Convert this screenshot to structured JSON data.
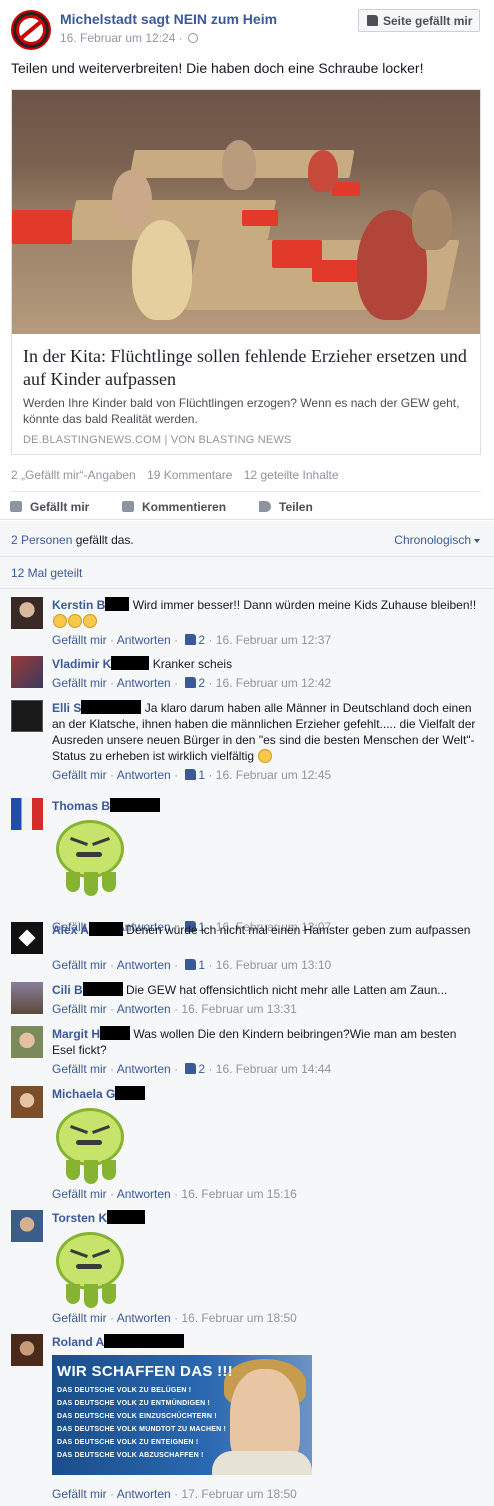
{
  "post": {
    "page_name": "Michelstadt sagt NEIN zum Heim",
    "time": "16. Februar um 12:24 ·",
    "like_page_button": "Seite gefällt mir",
    "text": "Teilen und weiterverbreiten! Die haben doch eine Schraube locker!",
    "card": {
      "title": "In der Kita: Flüchtlinge sollen fehlende Erzieher ersetzen und auf Kinder aufpassen",
      "description": "Werden Ihre Kinder bald von Flüchtlingen erzogen? Wenn es nach der GEW geht, könnte das bald Realität werden.",
      "source": "DE.BLASTINGNEWS.COM | VON BLASTING NEWS"
    },
    "stats": {
      "likes": "2 „Gefällt mir“-Angaben",
      "comments": "19 Kommentare",
      "shares": "12 geteilte Inhalte"
    },
    "actions": {
      "like": "Gefällt mir",
      "comment": "Kommentieren",
      "share": "Teilen"
    }
  },
  "comments_area": {
    "likes_people": "2 Personen",
    "likes_suffix": " gefällt das.",
    "sort_label": "Chronologisch",
    "shared_label": "12 Mal geteilt"
  },
  "comments": [
    {
      "name": "Kerstin B",
      "text": "Wird immer besser!! Dann würden meine Kids Zuhause bleiben!!",
      "like": "Gefällt mir",
      "reply": "Antworten",
      "likes": "2",
      "time": "16. Februar um 12:37"
    },
    {
      "name": "Vladimir K",
      "text": "Kranker scheis",
      "like": "Gefällt mir",
      "reply": "Antworten",
      "likes": "2",
      "time": "16. Februar um 12:42"
    },
    {
      "name": "Elli S",
      "text": "Ja klaro darum haben alle Männer in Deutschland doch einen an der Klatsche, ihnen haben die männlichen Erzieher gefehlt..... die Vielfalt der Ausreden unsere neuen Bürger in den \"es sind die besten Menschen der Welt\"-Status zu erheben ist wirklich vielfältig",
      "like": "Gefällt mir",
      "reply": "Antworten",
      "likes": "1",
      "time": "16. Februar um 12:45"
    },
    {
      "name": "Thomas B",
      "text": "",
      "like": "Gefällt mir",
      "reply": "Antworten",
      "likes": "1",
      "time": "16. Februar um 13:07"
    },
    {
      "name": "Alex A",
      "text": "Denen würde ich nicht mal einen Hamster geben zum aufpassen",
      "like": "Gefällt mir",
      "reply": "Antworten",
      "likes": "1",
      "time": "16. Februar um 13:10"
    },
    {
      "name": "Cili B",
      "text": "Die GEW hat offensichtlich nicht mehr alle Latten am Zaun...",
      "like": "Gefällt mir",
      "reply": "Antworten",
      "likes": "",
      "time": "16. Februar um 13:31"
    },
    {
      "name": "Margit H",
      "text": "Was wollen Die den Kindern beibringen?Wie man am besten Esel fickt?",
      "like": "Gefällt mir",
      "reply": "Antworten",
      "likes": "2",
      "time": "16. Februar um 14:44"
    },
    {
      "name": "Michaela G",
      "text": "",
      "like": "Gefällt mir",
      "reply": "Antworten",
      "likes": "",
      "time": "16. Februar um 15:16"
    },
    {
      "name": "Torsten K",
      "text": "",
      "like": "Gefällt mir",
      "reply": "Antworten",
      "likes": "",
      "time": "16. Februar um 18:50"
    },
    {
      "name": "Roland A",
      "text": "",
      "like": "Gefällt mir",
      "reply": "Antworten",
      "likes": "",
      "time": "17. Februar um 18:50"
    }
  ],
  "meme": {
    "headline": "WIR SCHAFFEN DAS !!!",
    "lines": [
      "DAS DEUTSCHE VOLK ZU BELÜGEN !",
      "DAS DEUTSCHE VOLK ZU ENTMÜNDIGEN !",
      "DAS DEUTSCHE VOLK EINZUSCHÜCHTERN !",
      "DAS DEUTSCHE VOLK MUNDTOT ZU MACHEN !",
      "DAS DEUTSCHE VOLK ZU ENTEIGNEN !",
      "DAS DEUTSCHE VOLK ABZUSCHAFFEN !"
    ]
  },
  "icons": {
    "like": "thumbs-up-icon",
    "comment": "speech-bubble-icon",
    "share": "share-arrow-icon",
    "privacy": "globe-icon"
  },
  "colors": {
    "link": "#3b5998",
    "meta": "#90949c",
    "background": "#f6f7f9"
  }
}
